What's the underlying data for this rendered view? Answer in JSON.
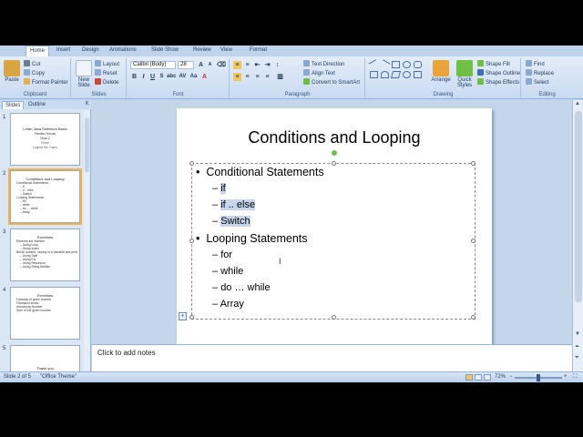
{
  "ribbon": {
    "tabs": [
      "Home",
      "Insert",
      "Design",
      "Animations",
      "Slide Show",
      "Review",
      "View",
      "Format"
    ],
    "clipboard": {
      "paste": "Paste",
      "cut": "Cut",
      "copy": "Copy",
      "format_painter": "Format Painter",
      "label": "Clipboard"
    },
    "slides": {
      "new_slide": "New Slide",
      "layout": "Layout",
      "reset": "Reset",
      "delete": "Delete",
      "label": "Slides"
    },
    "font": {
      "name": "Calibri (Body)",
      "size": "28",
      "label": "Font"
    },
    "paragraph": {
      "text_direction": "Text Direction",
      "align_text": "Align Text",
      "convert_smartart": "Convert to SmartArt",
      "label": "Paragraph"
    },
    "drawing": {
      "arrange": "Arrange",
      "quick_styles": "Quick Styles",
      "shape_fill": "Shape Fill",
      "shape_outline": "Shape Outline",
      "shape_effects": "Shape Effects",
      "label": "Drawing"
    },
    "editing": {
      "find": "Find",
      "replace": "Replace",
      "select": "Select",
      "label": "Editing"
    }
  },
  "pane": {
    "tab_slides": "Slides",
    "tab_outline": "Outline",
    "close": "x",
    "thumbs": [
      {
        "num": "1",
        "title": "Learn Java Selenium Basic Seven Hours",
        "lines": [
          "Hour 2",
          "Phani",
          "Logical Tek Tutors"
        ]
      },
      {
        "num": "2",
        "title": "Conditions and Looping",
        "lines": [
          "Conditional Statements",
          "– if",
          "– if .. else",
          "– Switch",
          "Looping Statements",
          "– for",
          "– while",
          "– do … while",
          "– Array"
        ]
      },
      {
        "num": "3",
        "title": "Exercises",
        "lines": [
          "Reverse the Number",
          "– Using Loop",
          "– Using Index",
          "Break number, storing in a Variable and print",
          "– Using Split",
          "– Using For",
          "– Using Recursion",
          "– Using String Builder"
        ]
      },
      {
        "num": "4",
        "title": "Exercises",
        "lines": [
          "Factorial of given number",
          "Fibonacci series",
          "Armstrong Number",
          "Sum of the given number"
        ]
      },
      {
        "num": "5",
        "title": "Thank you",
        "lines": []
      }
    ]
  },
  "slide": {
    "title": "Conditions and Looping",
    "bullets": [
      {
        "text": "Conditional Statements",
        "subs": [
          "if",
          "if .. else",
          "Switch"
        ]
      },
      {
        "text": "Looping Statements",
        "subs": [
          "for",
          "while",
          "do … while",
          "Array"
        ]
      }
    ]
  },
  "notes": {
    "placeholder": "Click to add notes"
  },
  "status": {
    "slide": "Slide 2 of 5",
    "theme": "\"Office Theme\"",
    "zoom": "72%"
  }
}
